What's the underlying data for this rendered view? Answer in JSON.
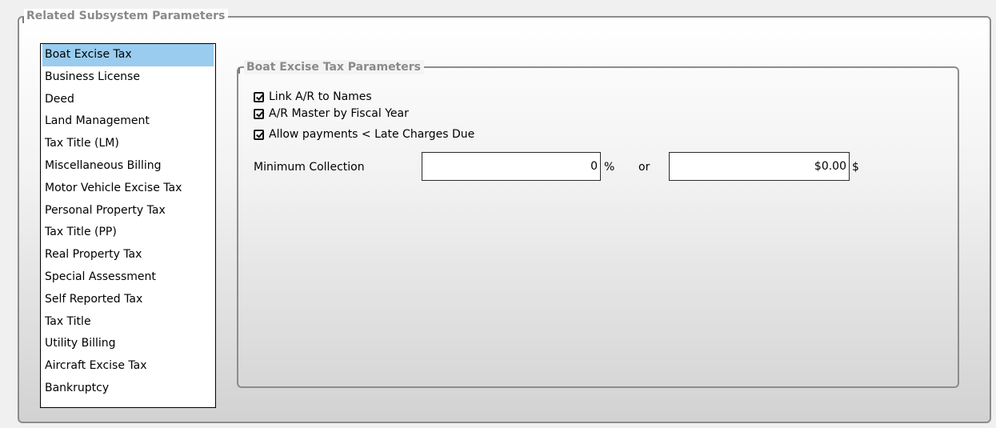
{
  "outer_group": {
    "title": "Related Subsystem Parameters"
  },
  "subsystems": {
    "selected_index": 0,
    "items": [
      "Boat Excise Tax",
      "Business License",
      "Deed",
      "Land Management",
      "Tax Title (LM)",
      "Miscellaneous  Billing",
      "Motor Vehicle Excise Tax",
      "Personal Property Tax",
      "Tax Title (PP)",
      "Real Property Tax",
      "Special Assessment",
      "Self Reported Tax",
      "Tax Title",
      "Utility Billing",
      "Aircraft Excise Tax",
      "Bankruptcy"
    ]
  },
  "params_group": {
    "title": "Boat Excise Tax Parameters",
    "checkboxes": [
      {
        "label": "Link A/R to Names",
        "checked": true
      },
      {
        "label": "A/R Master by Fiscal Year",
        "checked": true
      },
      {
        "label": "Allow payments < Late Charges Due",
        "checked": true
      }
    ],
    "min_collection": {
      "label": "Minimum Collection",
      "percent_value": "0",
      "percent_unit": "%",
      "or_text": "or",
      "amount_value": "$0.00",
      "amount_unit": "$"
    }
  },
  "colors": {
    "selection": "#99ccee",
    "group_title": "#8a8a8a",
    "group_border": "#8c8c8c"
  }
}
